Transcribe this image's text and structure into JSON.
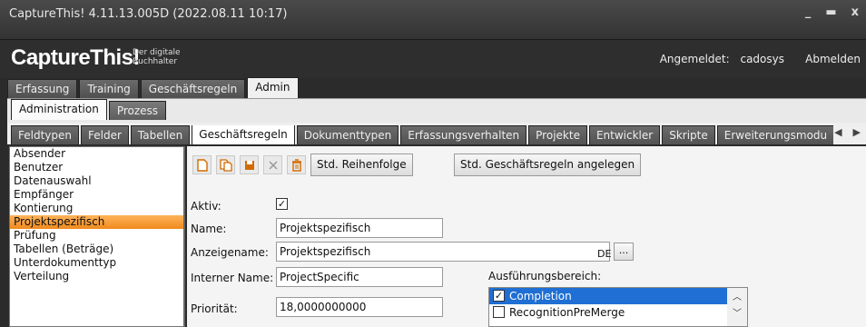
{
  "window": {
    "title": "CaptureThis! 4.11.13.005D (2022.08.11 10:17)",
    "minimize": "_",
    "maximize": "▬",
    "close": "x"
  },
  "header": {
    "brand": "CaptureThis!",
    "tagline": "Der digitale Buchhalter",
    "login_label": "Angemeldet:",
    "user": "cadosys",
    "logout": "Abmelden"
  },
  "tabs_main": [
    "Erfassung",
    "Training",
    "Geschäftsregeln",
    "Admin"
  ],
  "tabs_sub": [
    "Administration",
    "Prozess"
  ],
  "tabs_admin": [
    "Feldtypen",
    "Felder",
    "Tabellen",
    "Geschäftsregeln",
    "Dokumenttypen",
    "Erfassungsverhalten",
    "Projekte",
    "Entwickler",
    "Skripte",
    "Erweiterungsmodu"
  ],
  "sidebar": [
    "Absender",
    "Benutzer",
    "Datenauswahl",
    "Empfänger",
    "Kontierung",
    "Projektspezifisch",
    "Prüfung",
    "Tabellen (Beträge)",
    "Unterdokumenttyp",
    "Verteilung"
  ],
  "toolbar": {
    "std_order": "Std. Reihenfolge",
    "std_create": "Std. Geschäftsregeln angelegen"
  },
  "form": {
    "aktiv_label": "Aktiv:",
    "aktiv_check": "✓",
    "name_label": "Name:",
    "name_value": "Projektspezifisch",
    "anzeige_label": "Anzeigename:",
    "anzeige_value": "Projektspezifisch",
    "lang": "DE",
    "ellipsis": "...",
    "intern_label": "Interner Name:",
    "intern_value": "ProjectSpecific",
    "prio_label": "Priorität:",
    "prio_value": "18,0000000000",
    "exec_label": "Ausführungsbereich:",
    "exec_items": [
      {
        "label": "Completion",
        "check": "✓"
      },
      {
        "label": "RecognitionPreMerge",
        "check": ""
      }
    ]
  },
  "colors": {
    "selection_orange": "#f08a1c",
    "list_selection_blue": "#1f6fd4",
    "toolbar_icon_orange": "#d26a00"
  }
}
